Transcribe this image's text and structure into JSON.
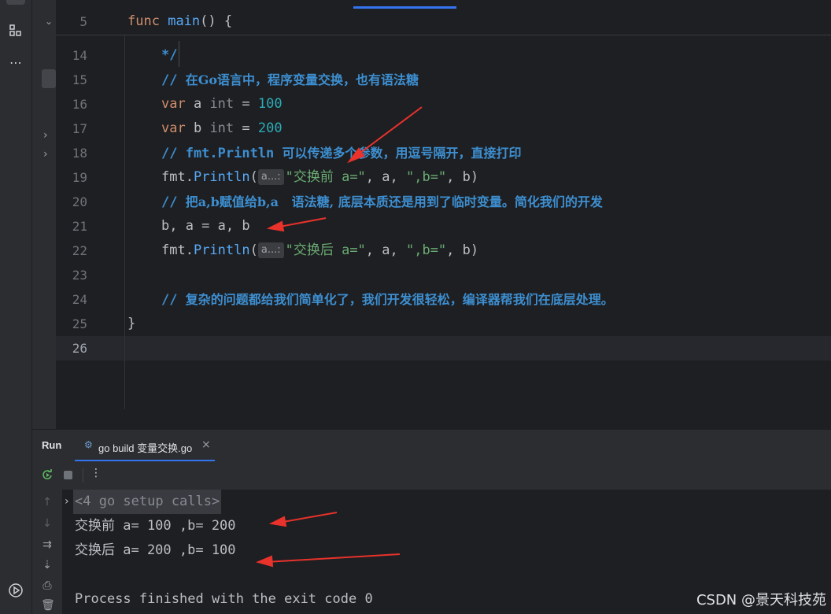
{
  "sticky_line": {
    "number": "5",
    "code_kw": "func",
    "code_fn": "main",
    "code_rest": "() {"
  },
  "lines": {
    "n14": "14",
    "n15": "15",
    "n16": "16",
    "n17": "17",
    "n18": "18",
    "n19": "19",
    "n20": "20",
    "n21": "21",
    "n22": "22",
    "n23": "23",
    "n24": "24",
    "n25": "25",
    "n26": "26",
    "l14": "*/",
    "l15_prefix": "// ",
    "l15_text": "在Go语言中，程序变量交换，也有语法糖",
    "l16_kw": "var",
    "l16_mid": " a ",
    "l16_type": "int",
    "l16_eq": " = ",
    "l16_num": "100",
    "l17_kw": "var",
    "l17_mid": " b ",
    "l17_type": "int",
    "l17_eq": " = ",
    "l17_num": "200",
    "l18_prefix": "// fmt.Println ",
    "l18_text": "可以传递多个参数，用逗号隔开，直接打印",
    "l19_pkg": "fmt.",
    "l19_fn": "Println",
    "l19_open": "(",
    "l19_hint": "a...:",
    "l19_str1": "\"交换前 a=\"",
    "l19_mid": ", a, ",
    "l19_str2": "\",b=\"",
    "l19_end": ", b)",
    "l20_prefix": "// ",
    "l20_text": "把a,b赋值给b,a   语法糖, 底层本质还是用到了临时变量。简化我们的开发",
    "l21": "b, a = a, b",
    "l22_pkg": "fmt.",
    "l22_fn": "Println",
    "l22_open": "(",
    "l22_hint": "a...:",
    "l22_str1": "\"交换后 a=\"",
    "l22_mid": ", a, ",
    "l22_str2": "\",b=\"",
    "l22_end": ", b)",
    "l24_prefix": "// ",
    "l24_text": "复杂的问题都给我们简单化了，我们开发很轻松，编译器帮我们在底层处理。",
    "l25": "}"
  },
  "run_panel": {
    "title": "Run",
    "tab_label": "go build 变量交换.go",
    "close": "×"
  },
  "console": {
    "setup": "<4 go setup calls>",
    "out1": "交换前 a= 100 ,b= 200",
    "out2": "交换后 a= 200 ,b= 100",
    "exit": "Process finished with the exit code 0"
  },
  "watermark": "CSDN @景天科技苑",
  "colors": {
    "keyword": "#cf8e6d",
    "function": "#56a8f5",
    "number": "#2aacb8",
    "string": "#6aab73",
    "comment": "#3d8fd1",
    "arrow": "#e8322b"
  }
}
